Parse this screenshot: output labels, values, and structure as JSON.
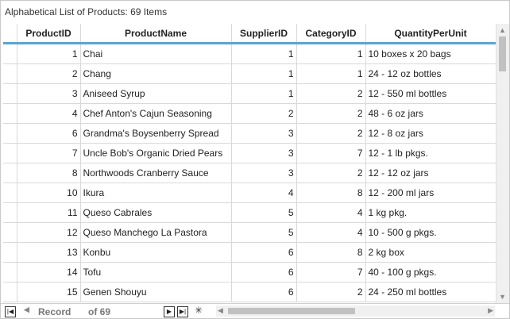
{
  "caption": "Alphabetical List of Products: 69 Items",
  "columns": [
    "ProductID",
    "ProductName",
    "SupplierID",
    "CategoryID",
    "QuantityPerUnit"
  ],
  "rows": [
    [
      "1",
      "Chai",
      "1",
      "1",
      "10 boxes x 20 bags"
    ],
    [
      "2",
      "Chang",
      "1",
      "1",
      "24 - 12 oz bottles"
    ],
    [
      "3",
      "Aniseed Syrup",
      "1",
      "2",
      "12 - 550 ml bottles"
    ],
    [
      "4",
      "Chef Anton's Cajun Seasoning",
      "2",
      "2",
      "48 - 6 oz jars"
    ],
    [
      "6",
      "Grandma's Boysenberry Spread",
      "3",
      "2",
      "12 - 8 oz jars"
    ],
    [
      "7",
      "Uncle Bob's Organic Dried Pears",
      "3",
      "7",
      "12 - 1 lb pkgs."
    ],
    [
      "8",
      "Northwoods Cranberry Sauce",
      "3",
      "2",
      "12 - 12 oz jars"
    ],
    [
      "10",
      "Ikura",
      "4",
      "8",
      "12 - 200 ml jars"
    ],
    [
      "11",
      "Queso Cabrales",
      "5",
      "4",
      "1 kg pkg."
    ],
    [
      "12",
      "Queso Manchego La Pastora",
      "5",
      "4",
      "10 - 500 g pkgs."
    ],
    [
      "13",
      "Konbu",
      "6",
      "8",
      "2 kg box"
    ],
    [
      "14",
      "Tofu",
      "6",
      "7",
      "40 - 100 g pkgs."
    ],
    [
      "15",
      "Genen Shouyu",
      "6",
      "2",
      "24 - 250 ml bottles"
    ]
  ],
  "navigator": {
    "record_label": "Record",
    "of_label": "of 69"
  }
}
